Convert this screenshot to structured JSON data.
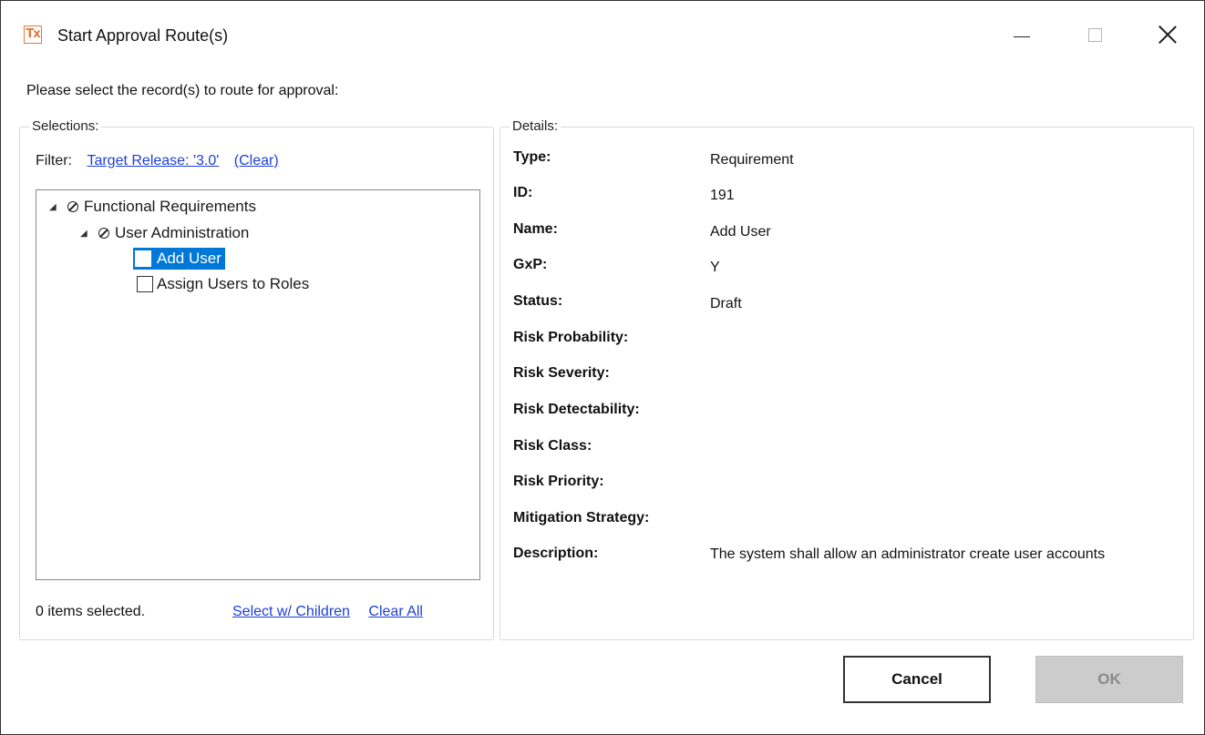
{
  "window": {
    "title": "Start Approval Route(s)",
    "app_icon": "Tx"
  },
  "prompt": "Please select the record(s) to route for approval:",
  "selections": {
    "legend": "Selections:",
    "filter_label": "Filter:",
    "filter_value": "Target Release: '3.0'",
    "filter_clear": "(Clear)",
    "tree": [
      {
        "label": "Functional Requirements",
        "level": 0,
        "expanded": true,
        "icon": "no-entry-icon"
      },
      {
        "label": "User Administration",
        "level": 1,
        "expanded": true,
        "icon": "no-entry-icon"
      },
      {
        "label": "Add User",
        "level": 2,
        "checked": false,
        "selected": true
      },
      {
        "label": "Assign Users to Roles",
        "level": 2,
        "checked": false,
        "selected": false
      }
    ],
    "status": "0 items selected.",
    "select_children": "Select w/ Children",
    "clear_all": "Clear All"
  },
  "details": {
    "legend": "Details:",
    "fields": [
      {
        "label": "Type:",
        "value": "Requirement"
      },
      {
        "label": "ID:",
        "value": "191"
      },
      {
        "label": "Name:",
        "value": "Add User"
      },
      {
        "label": "GxP:",
        "value": "Y"
      },
      {
        "label": "Status:",
        "value": "Draft"
      },
      {
        "label": "Risk Probability:",
        "value": ""
      },
      {
        "label": "Risk Severity:",
        "value": ""
      },
      {
        "label": "Risk Detectability:",
        "value": ""
      },
      {
        "label": "Risk Class:",
        "value": ""
      },
      {
        "label": "Risk Priority:",
        "value": ""
      },
      {
        "label": "Mitigation Strategy:",
        "value": ""
      },
      {
        "label": "Description:",
        "value": "The system shall allow an administrator create user accounts"
      }
    ]
  },
  "buttons": {
    "cancel": "Cancel",
    "ok": "OK"
  }
}
